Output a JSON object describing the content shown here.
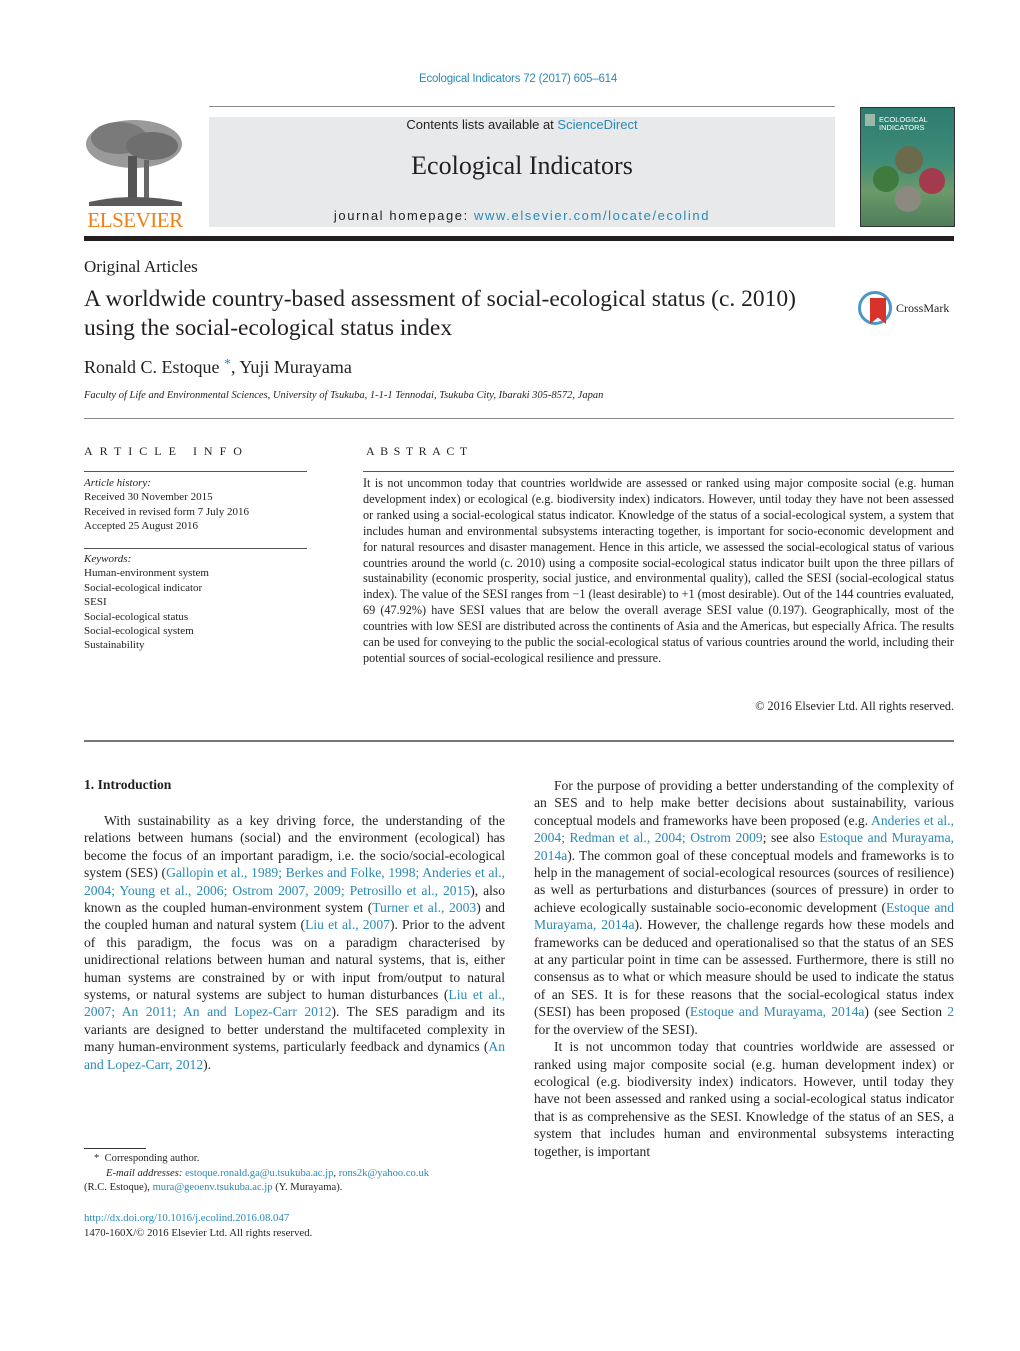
{
  "header": {
    "journal_ref": "Ecological Indicators 72 (2017) 605–614",
    "contents_prefix": "Contents lists available at ",
    "contents_link": "ScienceDirect",
    "journal_name": "Ecological Indicators",
    "homepage_prefix": "journal homepage: ",
    "homepage_link": "www.elsevier.com/locate/ecolind",
    "publisher_logo_text": "ELSEVIER",
    "cover_title_line1": "ECOLOGICAL",
    "cover_title_line2": "INDICATORS",
    "colors": {
      "link": "#2a8ab6",
      "elsevier_orange": "#f07e14",
      "banner_bg": "#e8e9ea"
    }
  },
  "article": {
    "section_type": "Original Articles",
    "title": "A worldwide country-based assessment of social-ecological status (c. 2010) using the social-ecological status index",
    "crossmark_label": "CrossMark",
    "author1": "Ronald C. Estoque",
    "author1_mark": "*",
    "author_sep": ", ",
    "author2": "Yuji Murayama",
    "affiliation": "Faculty of Life and Environmental Sciences, University of Tsukuba, 1-1-1 Tennodai, Tsukuba City, Ibaraki 305-8572, Japan"
  },
  "article_info": {
    "heading": "ARTICLE INFO",
    "history_label": "Article history:",
    "history": [
      "Received 30 November 2015",
      "Received in revised form 7 July 2016",
      "Accepted 25 August 2016"
    ],
    "keywords_label": "Keywords:",
    "keywords": [
      "Human-environment system",
      "Social-ecological indicator",
      "SESI",
      "Social-ecological status",
      "Social-ecological system",
      "Sustainability"
    ]
  },
  "abstract": {
    "heading": "ABSTRACT",
    "text": "It is not uncommon today that countries worldwide are assessed or ranked using major composite social (e.g. human development index) or ecological (e.g. biodiversity index) indicators. However, until today they have not been assessed or ranked using a social-ecological status indicator. Knowledge of the status of a social-ecological system, a system that includes human and environmental subsystems interacting together, is important for socio-economic development and for natural resources and disaster management. Hence in this article, we assessed the social-ecological status of various countries around the world (c. 2010) using a composite social-ecological status indicator built upon the three pillars of sustainability (economic prosperity, social justice, and environmental quality), called the SESI (social-ecological status index). The value of the SESI ranges from −1 (least desirable) to +1 (most desirable). Out of the 144 countries evaluated, 69 (47.92%) have SESI values that are below the overall average SESI value (0.197). Geographically, most of the countries with low SESI are distributed across the continents of Asia and the Americas, but especially Africa. The results can be used for conveying to the public the social-ecological status of various countries around the world, including their potential sources of social-ecological resilience and pressure.",
    "copyright": "© 2016 Elsevier Ltd. All rights reserved."
  },
  "body": {
    "section_heading": "1.  Introduction",
    "left_p1": [
      {
        "t": "With sustainability as a key driving force, the understanding of the relations between humans (social) and the environment (ecological) has become the focus of an important paradigm, i.e. the socio/social-ecological system (SES) ("
      },
      {
        "l": "Gallopin et al., 1989; Berkes and Folke, 1998; Anderies et al., 2004; Young et al., 2006; Ostrom 2007, 2009; Petrosillo et al., 2015"
      },
      {
        "t": "), also known as the coupled human-environment system ("
      },
      {
        "l": "Turner et al., 2003"
      },
      {
        "t": ") and the coupled human and natural system ("
      },
      {
        "l": "Liu et al., 2007"
      },
      {
        "t": "). Prior to the advent of this paradigm, the focus was on a paradigm characterised by unidirectional relations between human and natural systems, that is, either human systems are constrained by or with input from/output to natural systems, or natural systems are subject to human disturbances ("
      },
      {
        "l": "Liu et al., 2007; An 2011; An and Lopez-Carr 2012"
      },
      {
        "t": "). The SES paradigm and its variants are designed to better understand the multifaceted complexity in many human-environment systems, particularly feedback and dynamics ("
      },
      {
        "l": "An and Lopez-Carr, 2012"
      },
      {
        "t": ")."
      }
    ],
    "right_p1": [
      {
        "t": "For the purpose of providing a better understanding of the complexity of an SES and to help make better decisions about sustainability, various conceptual models and frameworks have been proposed (e.g. "
      },
      {
        "l": "Anderies et al., 2004; Redman et al., 2004; Ostrom 2009"
      },
      {
        "t": "; see also "
      },
      {
        "l": "Estoque and Murayama, 2014a"
      },
      {
        "t": "). The common goal of these conceptual models and frameworks is to help in the management of social-ecological resources (sources of resilience) as well as perturbations and disturbances (sources of pressure) in order to achieve ecologically sustainable socio-economic development ("
      },
      {
        "l": "Estoque and Murayama, 2014a"
      },
      {
        "t": "). However, the challenge regards how these models and frameworks can be deduced and operationalised so that the status of an SES at any particular point in time can be assessed. Furthermore, there is still no consensus as to what or which measure should be used to indicate the status of an SES. It is for these reasons that the social-ecological status index (SESI) has been proposed ("
      },
      {
        "l": "Estoque and Murayama, 2014a"
      },
      {
        "t": ") (see Section "
      },
      {
        "l": "2"
      },
      {
        "t": " for the overview of the SESI)."
      }
    ],
    "right_p2": "It is not uncommon today that countries worldwide are assessed or ranked using major composite social (e.g. human development index) or ecological (e.g. biodiversity index) indicators. However, until today they have not been assessed and ranked using a social-ecological status indicator that is as comprehensive as the SESI. Knowledge of the status of an SES, a system that includes human and environmental subsystems interacting together, is important"
  },
  "footnote": {
    "mark": "*",
    "corresponding": "Corresponding author.",
    "email_label": "E-mail addresses:",
    "email1": "estoque.ronald.ga@u.tsukuba.ac.jp",
    "email2": "rons2k@yahoo.co.uk",
    "email1_owner": "(R.C. Estoque), ",
    "email3": "mura@geoenv.tsukuba.ac.jp",
    "email3_owner": " (Y. Murayama)."
  },
  "doi": {
    "url": "http://dx.doi.org/10.1016/j.ecolind.2016.08.047",
    "issn_line": "1470-160X/© 2016 Elsevier Ltd. All rights reserved."
  }
}
